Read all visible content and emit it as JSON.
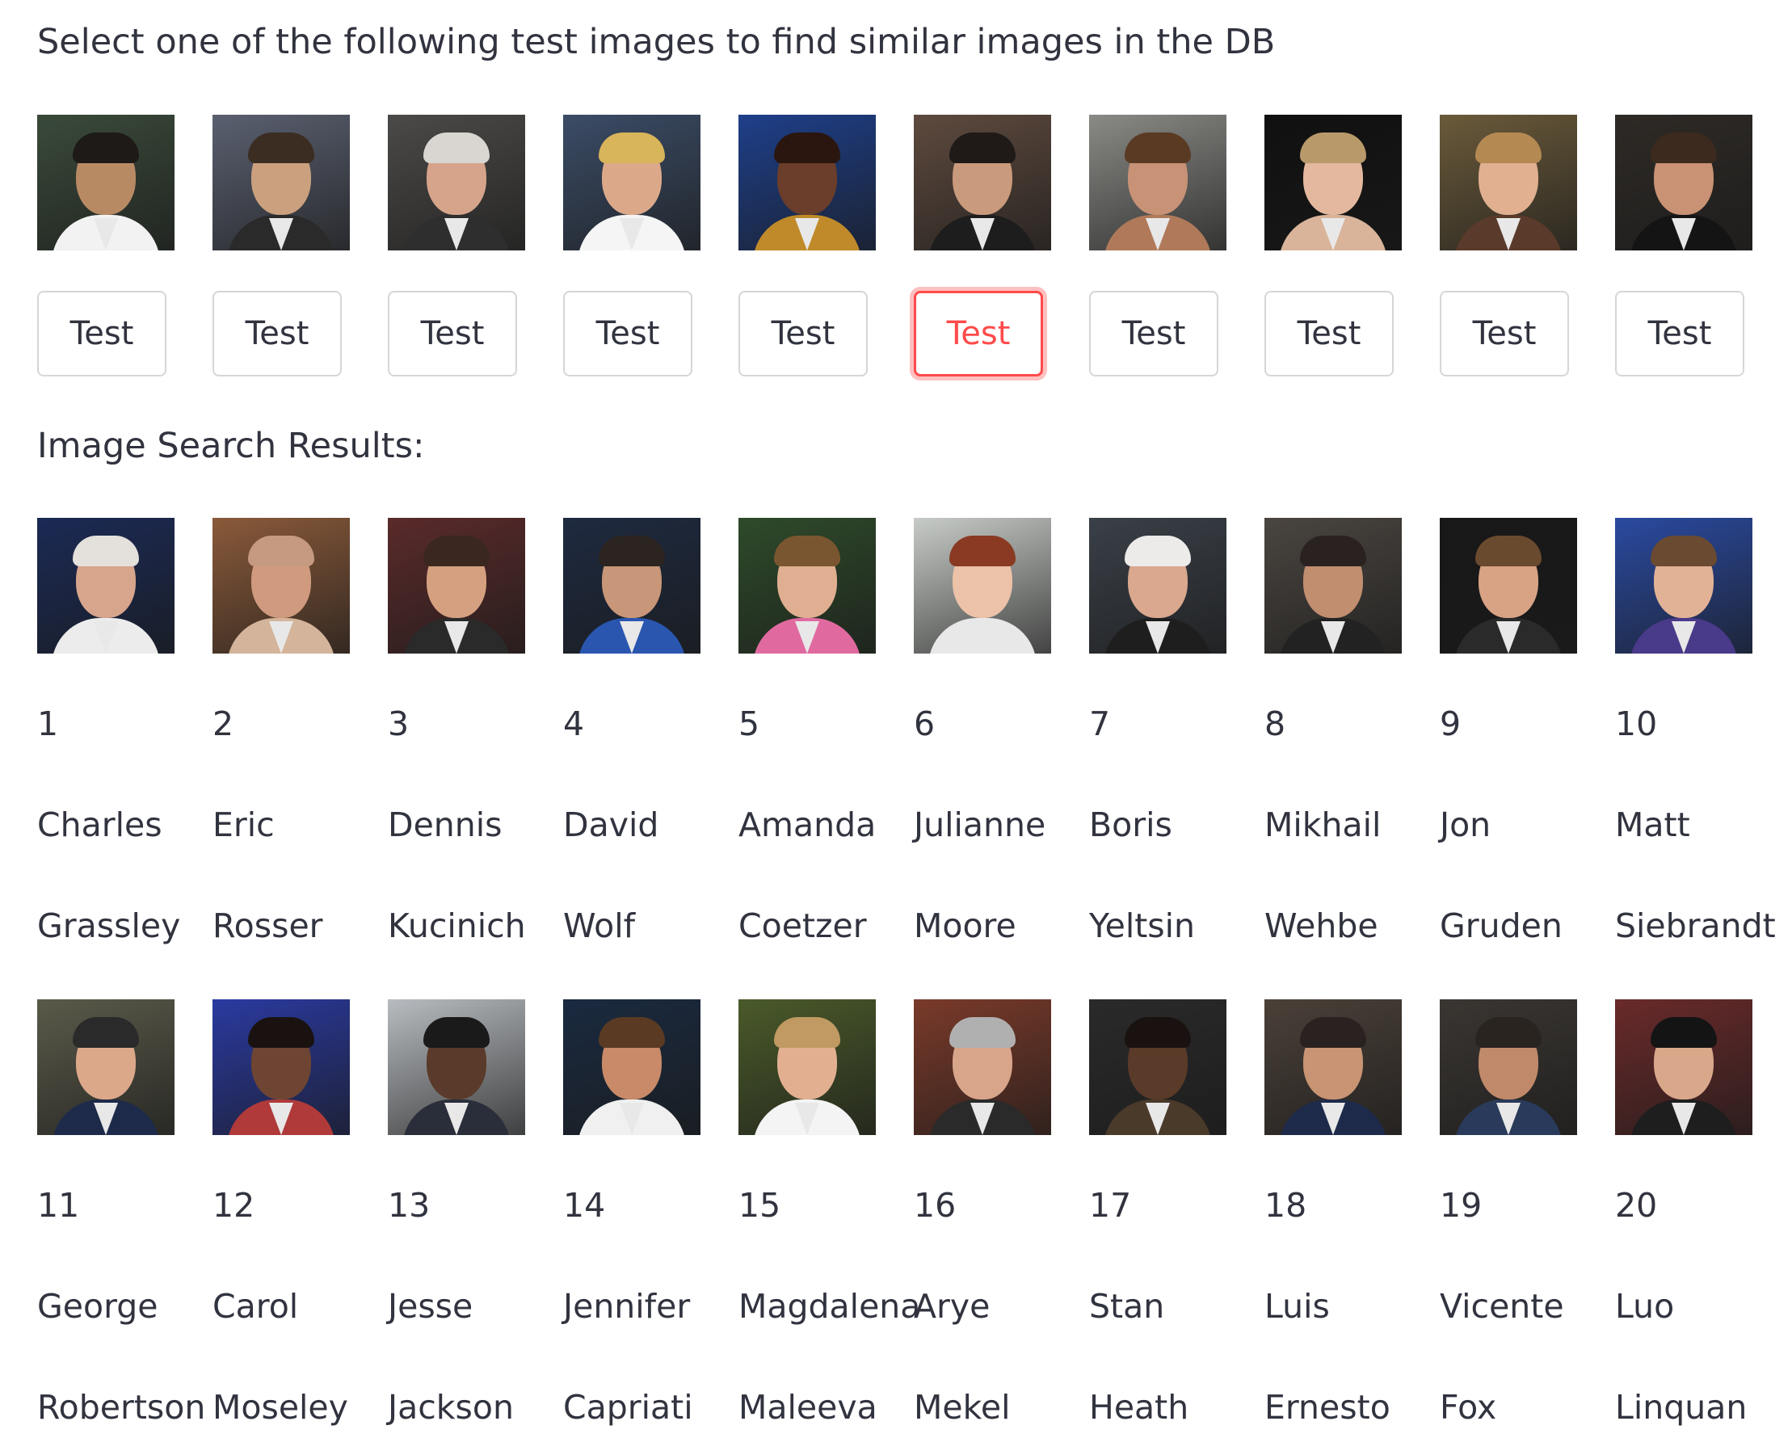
{
  "heading": "Select one of the following test images to find similar images in the DB",
  "results_heading": "Image Search Results:",
  "test_button_label": "Test",
  "selected_test_index": 5,
  "colors": {
    "accent": "#ff4b4b",
    "text": "#31333f",
    "border": "#d6d6d9"
  },
  "test_images": [
    {
      "bg": "#3a4a3a",
      "skin": "#b88a64",
      "hair": "#1d1a18",
      "shirt": "#f2f2f2"
    },
    {
      "bg": "#5a6070",
      "skin": "#caa07e",
      "hair": "#3b2d22",
      "shirt": "#2a2a2a"
    },
    {
      "bg": "#4c4a48",
      "skin": "#d6a48a",
      "hair": "#d9d6d2",
      "shirt": "#2e2e2e"
    },
    {
      "bg": "#3b4c66",
      "skin": "#dba98a",
      "hair": "#d8b45a",
      "shirt": "#f5f5f5"
    },
    {
      "bg": "#1e3f8a",
      "skin": "#6a3e2a",
      "hair": "#2a160e",
      "shirt": "#c08a2a"
    },
    {
      "bg": "#5e4a3e",
      "skin": "#c99a7c",
      "hair": "#1f1a18",
      "shirt": "#1d1d1d"
    },
    {
      "bg": "#8a8a86",
      "skin": "#c89276",
      "hair": "#5a3a22",
      "shirt": "#b07a5a"
    },
    {
      "bg": "#101010",
      "skin": "#e3b89e",
      "hair": "#b89a6a",
      "shirt": "#d9b49a"
    },
    {
      "bg": "#6a5a3a",
      "skin": "#e0b090",
      "hair": "#b58a52",
      "shirt": "#5a3a2a"
    },
    {
      "bg": "#2e2a26",
      "skin": "#c99274",
      "hair": "#3c2a1e",
      "shirt": "#141414"
    }
  ],
  "results": [
    {
      "rank": "1",
      "first": "Charles",
      "last": "Grassley",
      "bg": "#1b2a55",
      "skin": "#d7a48c",
      "hair": "#e4e0dc",
      "shirt": "#ececec"
    },
    {
      "rank": "2",
      "first": "Eric",
      "last": "Rosser",
      "bg": "#8a5a3a",
      "skin": "#cf9a7e",
      "hair": "#c69a80",
      "shirt": "#d4b49a"
    },
    {
      "rank": "3",
      "first": "Dennis",
      "last": "Kucinich",
      "bg": "#5a2a2a",
      "skin": "#d4a080",
      "hair": "#3a2820",
      "shirt": "#2a2a2a"
    },
    {
      "rank": "4",
      "first": "David",
      "last": "Wolf",
      "bg": "#1e2a40",
      "skin": "#c89678",
      "hair": "#2c2420",
      "shirt": "#2a56b0"
    },
    {
      "rank": "5",
      "first": "Amanda",
      "last": "Coetzer",
      "bg": "#2e4a2a",
      "skin": "#e0ae90",
      "hair": "#7a5630",
      "shirt": "#e06aa0"
    },
    {
      "rank": "6",
      "first": "Julianne",
      "last": "Moore",
      "bg": "#c8ccc8",
      "skin": "#ecc2a8",
      "hair": "#8a3a22",
      "shirt": "#e8e8e8"
    },
    {
      "rank": "7",
      "first": "Boris",
      "last": "Yeltsin",
      "bg": "#3a4048",
      "skin": "#d9a88e",
      "hair": "#ecebea",
      "shirt": "#1e1e1e"
    },
    {
      "rank": "8",
      "first": "Mikhail",
      "last": "Wehbe",
      "bg": "#4a4540",
      "skin": "#c18e70",
      "hair": "#2a2220",
      "shirt": "#222222"
    },
    {
      "rank": "9",
      "first": "Jon",
      "last": "Gruden",
      "bg": "#181818",
      "skin": "#d8a284",
      "hair": "#6a4a2e",
      "shirt": "#2a2a2a"
    },
    {
      "rank": "10",
      "first": "Matt",
      "last": "Siebrandt",
      "bg": "#2a4aa0",
      "skin": "#e2b296",
      "hair": "#6a4a30",
      "shirt": "#4a3a8a"
    },
    {
      "rank": "11",
      "first": "George",
      "last": "Robertson",
      "bg": "#5a5a4a",
      "skin": "#dca88a",
      "hair": "#2a2a2a",
      "shirt": "#1e2a4a"
    },
    {
      "rank": "12",
      "first": "Carol",
      "last": "Moseley",
      "bg": "#2a3aa0",
      "skin": "#6e4532",
      "hair": "#1a1210",
      "shirt": "#b03a3a"
    },
    {
      "rank": "13",
      "first": "Jesse",
      "last": "Jackson",
      "bg": "#b8bcc0",
      "skin": "#5a3a2a",
      "hair": "#1a1a1a",
      "shirt": "#2a2e3a"
    },
    {
      "rank": "14",
      "first": "Jennifer",
      "last": "Capriati",
      "bg": "#1a2a40",
      "skin": "#c88a68",
      "hair": "#5a3a22",
      "shirt": "#f0f0f0"
    },
    {
      "rank": "15",
      "first": "Magdalena",
      "last": "Maleeva",
      "bg": "#4a5a2a",
      "skin": "#e2b090",
      "hair": "#c09a62",
      "shirt": "#f4f4f4"
    },
    {
      "rank": "16",
      "first": "Arye",
      "last": "Mekel",
      "bg": "#7a3a2a",
      "skin": "#d8a48a",
      "hair": "#b0b0b0",
      "shirt": "#2a2a2a"
    },
    {
      "rank": "17",
      "first": "Stan",
      "last": "Heath",
      "bg": "#2a2a2a",
      "skin": "#5a3a28",
      "hair": "#1a1210",
      "shirt": "#4a3a2a"
    },
    {
      "rank": "18",
      "first": "Luis",
      "last": "Ernesto",
      "bg": "#4a4038",
      "skin": "#c89474",
      "hair": "#2a2220",
      "shirt": "#1e2a4a"
    },
    {
      "rank": "19",
      "first": "Vicente",
      "last": "Fox",
      "bg": "#3a3632",
      "skin": "#c08a6a",
      "hair": "#2a2420",
      "shirt": "#2a3a5a"
    },
    {
      "rank": "20",
      "first": "Luo",
      "last": "Linquan",
      "bg": "#6a2a2a",
      "skin": "#d9a88a",
      "hair": "#141414",
      "shirt": "#1e1e1e"
    }
  ]
}
